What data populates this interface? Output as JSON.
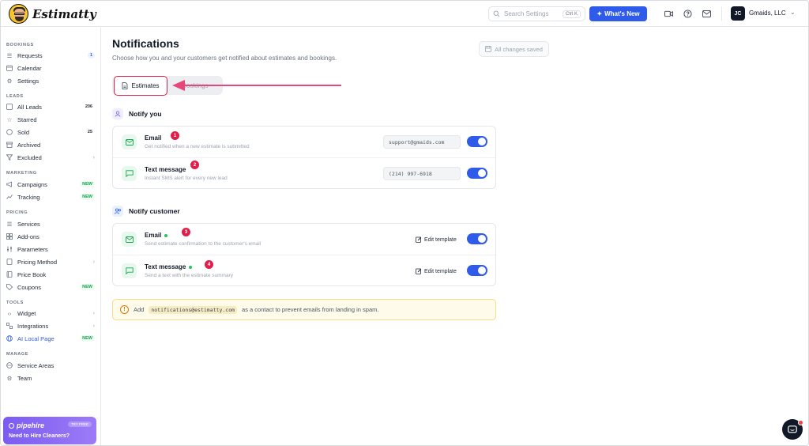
{
  "app": {
    "name": "Estimatty"
  },
  "topbar": {
    "search_placeholder": "Search Settings",
    "search_shortcut": "Ctrl K",
    "whats_new": "What's New",
    "avatar_initials": "JC",
    "company": "Gmaids, LLC"
  },
  "sidebar": {
    "sections": {
      "bookings": "BOOKINGS",
      "leads": "LEADS",
      "marketing": "MARKETING",
      "pricing": "PRICING",
      "tools": "TOOLS",
      "manage": "MANAGE"
    },
    "items": {
      "requests": {
        "label": "Requests",
        "badge": "1"
      },
      "calendar": {
        "label": "Calendar"
      },
      "settings": {
        "label": "Settings"
      },
      "all_leads": {
        "label": "All Leads",
        "badge": "206"
      },
      "starred": {
        "label": "Starred"
      },
      "sold": {
        "label": "Sold",
        "badge": "25"
      },
      "archived": {
        "label": "Archived"
      },
      "excluded": {
        "label": "Excluded"
      },
      "campaigns": {
        "label": "Campaigns",
        "badge": "NEW"
      },
      "tracking": {
        "label": "Tracking",
        "badge": "NEW"
      },
      "services": {
        "label": "Services"
      },
      "addons": {
        "label": "Add-ons"
      },
      "parameters": {
        "label": "Parameters"
      },
      "pricing_method": {
        "label": "Pricing Method"
      },
      "price_book": {
        "label": "Price Book"
      },
      "coupons": {
        "label": "Coupons",
        "badge": "NEW"
      },
      "widget": {
        "label": "Widget"
      },
      "integrations": {
        "label": "Integrations"
      },
      "ai_local_page": {
        "label": "AI Local Page",
        "badge": "NEW"
      },
      "service_areas": {
        "label": "Service Areas"
      },
      "team": {
        "label": "Team"
      }
    },
    "promo": {
      "brand": "pipehire",
      "pill": "TRY FREE",
      "cta": "Need to Hire Cleaners?"
    }
  },
  "page": {
    "title": "Notifications",
    "subtitle": "Choose how you and your customers get notified about estimates and bookings.",
    "saved_status": "All changes saved",
    "tabs": {
      "estimates": "Estimates",
      "bookings": "Bookings"
    }
  },
  "notify_you": {
    "heading": "Notify you",
    "rows": [
      {
        "title": "Email",
        "subtitle": "Get notified when a new estimate is submitted",
        "value": "support@gmaids.com",
        "marker": "1",
        "enabled": true
      },
      {
        "title": "Text message",
        "subtitle": "Instant SMS alert for every new lead",
        "value": "(214) 997-6918",
        "marker": "2",
        "enabled": true
      }
    ]
  },
  "notify_customer": {
    "heading": "Notify customer",
    "edit_label": "Edit template",
    "rows": [
      {
        "title": "Email",
        "subtitle": "Send estimate confirmation to the customer's email",
        "marker": "3",
        "enabled": true
      },
      {
        "title": "Text message",
        "subtitle": "Send a text with the estimate summary",
        "marker": "4",
        "enabled": true
      }
    ]
  },
  "banner": {
    "prefix": "Add",
    "email": "notifications@estimatty.com",
    "suffix": "as a contact to prevent emails from landing in spam."
  },
  "colors": {
    "accent": "#2f5bea",
    "annotation": "#e11d48",
    "success": "#22c55e",
    "warning": "#d97706"
  }
}
